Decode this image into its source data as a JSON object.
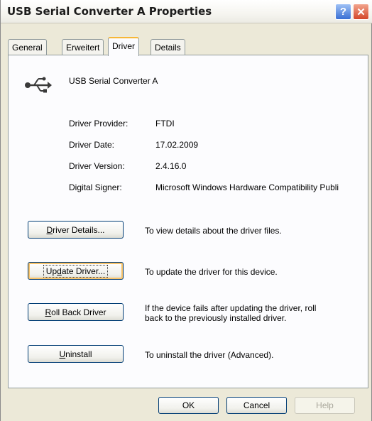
{
  "window": {
    "title": "USB Serial Converter A Properties"
  },
  "titlebar": {
    "help_label": "?",
    "close_label": "✕"
  },
  "tabs": [
    {
      "label": "General"
    },
    {
      "label": "Erweitert"
    },
    {
      "label": "Driver"
    },
    {
      "label": "Details"
    }
  ],
  "device": {
    "name": "USB Serial Converter A",
    "icon": "usb-icon"
  },
  "driver_info": {
    "provider_label": "Driver Provider:",
    "provider_value": "FTDI",
    "date_label": "Driver Date:",
    "date_value": "17.02.2009",
    "version_label": "Driver Version:",
    "version_value": "2.4.16.0",
    "signer_label": "Digital Signer:",
    "signer_value": "Microsoft Windows Hardware Compatibility Publi"
  },
  "actions": {
    "details": {
      "mnemonic": "D",
      "rest": "river Details...",
      "desc": "To view details about the driver files."
    },
    "update": {
      "before": "Up",
      "mnemonic": "d",
      "rest": "ate Driver...",
      "desc": "To update the driver for this device."
    },
    "rollback": {
      "mnemonic": "R",
      "rest": "oll Back Driver",
      "desc_line1": "If the device fails after updating the driver, roll",
      "desc_line2": "back to the previously installed driver."
    },
    "uninstall": {
      "mnemonic": "U",
      "rest": "ninstall",
      "desc": "To uninstall the driver (Advanced)."
    }
  },
  "footer": {
    "ok_label": "OK",
    "cancel_label": "Cancel",
    "help_label": "Help"
  }
}
